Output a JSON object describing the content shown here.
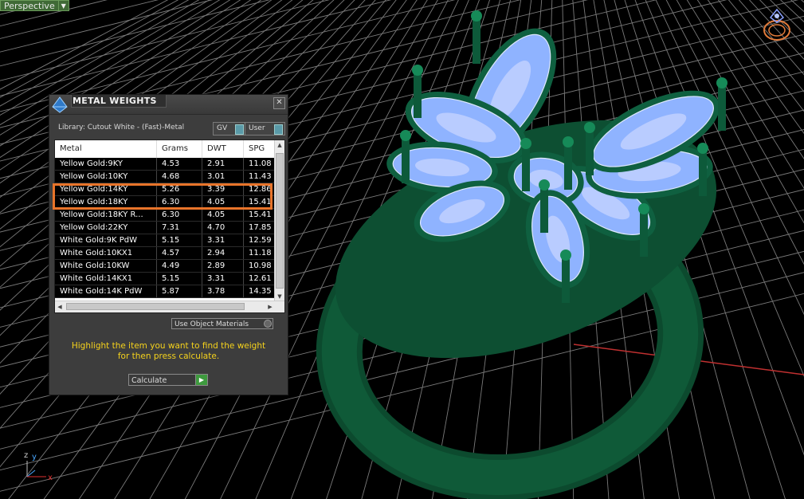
{
  "viewport": {
    "label": "Perspective",
    "axis_labels": {
      "z": "z",
      "y": "y",
      "x": "x"
    }
  },
  "panel": {
    "title": "METAL WEIGHTS",
    "close_glyph": "✕",
    "library_label": "Library: Cutout White - (Fast)-Metal",
    "toggles": {
      "gv": "GV",
      "user": "User"
    },
    "columns": [
      "Metal",
      "Grams",
      "DWT",
      "SPG"
    ],
    "rows": [
      {
        "metal": "Yellow Gold:9KY",
        "grams": "4.53",
        "dwt": "2.91",
        "spg": "11.08"
      },
      {
        "metal": "Yellow Gold:10KY",
        "grams": "4.68",
        "dwt": "3.01",
        "spg": "11.43"
      },
      {
        "metal": "Yellow Gold:14KY",
        "grams": "5.26",
        "dwt": "3.39",
        "spg": "12.86"
      },
      {
        "metal": "Yellow Gold:18KY",
        "grams": "6.30",
        "dwt": "4.05",
        "spg": "15.41"
      },
      {
        "metal": "Yellow Gold:18KY R...",
        "grams": "6.30",
        "dwt": "4.05",
        "spg": "15.41"
      },
      {
        "metal": "Yellow Gold:22KY",
        "grams": "7.31",
        "dwt": "4.70",
        "spg": "17.85"
      },
      {
        "metal": "White Gold:9K PdW",
        "grams": "5.15",
        "dwt": "3.31",
        "spg": "12.59"
      },
      {
        "metal": "White Gold:10KX1",
        "grams": "4.57",
        "dwt": "2.94",
        "spg": "11.18"
      },
      {
        "metal": "White Gold:10KW",
        "grams": "4.49",
        "dwt": "2.89",
        "spg": "10.98"
      },
      {
        "metal": "White Gold:14KX1",
        "grams": "5.15",
        "dwt": "3.31",
        "spg": "12.61"
      },
      {
        "metal": "White Gold:14K PdW",
        "grams": "5.87",
        "dwt": "3.78",
        "spg": "14.35"
      }
    ],
    "material_select": "Use Object Materials",
    "message_line1": "Highlight the item you want to find the weight",
    "message_line2": "for then press calculate.",
    "calculate_label": "Calculate"
  },
  "colors": {
    "highlight": "#e8742a",
    "message": "#f5d21c",
    "grid": "#7a7a7a",
    "ring": "#0f5a38",
    "gem": "#8fb3ff"
  }
}
